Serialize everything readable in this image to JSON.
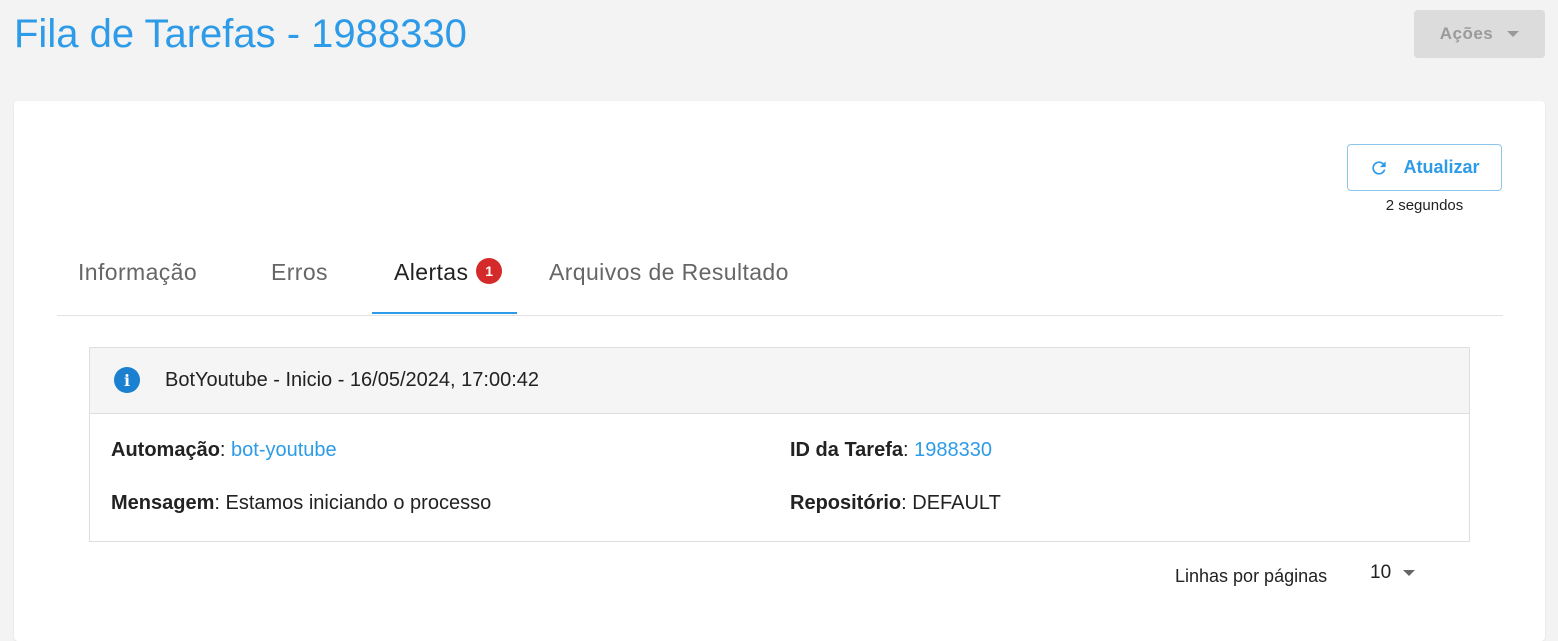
{
  "header": {
    "title": "Fila de Tarefas - 1988330",
    "actions_label": "Ações"
  },
  "refresh": {
    "label": "Atualizar",
    "elapsed": "2 segundos"
  },
  "tabs": [
    {
      "label": "Informação",
      "active": false
    },
    {
      "label": "Erros",
      "active": false
    },
    {
      "label": "Alertas",
      "active": true,
      "badge": "1"
    },
    {
      "label": "Arquivos de Resultado",
      "active": false
    }
  ],
  "alert": {
    "icon": "info-icon",
    "title": "BotYoutube - Inicio - 16/05/2024, 17:00:42",
    "automation_label": "Automação",
    "automation_value": "bot-youtube",
    "task_id_label": "ID da Tarefa",
    "task_id_value": "1988330",
    "message_label": "Mensagem",
    "message_value": "Estamos iniciando o processo",
    "repository_label": "Repositório",
    "repository_value": "DEFAULT"
  },
  "pagination": {
    "rows_label": "Linhas por páginas",
    "rows_value": "10"
  },
  "colors": {
    "accent": "#2d9be7",
    "badge": "#d42a2a",
    "info": "#1b80d0"
  }
}
